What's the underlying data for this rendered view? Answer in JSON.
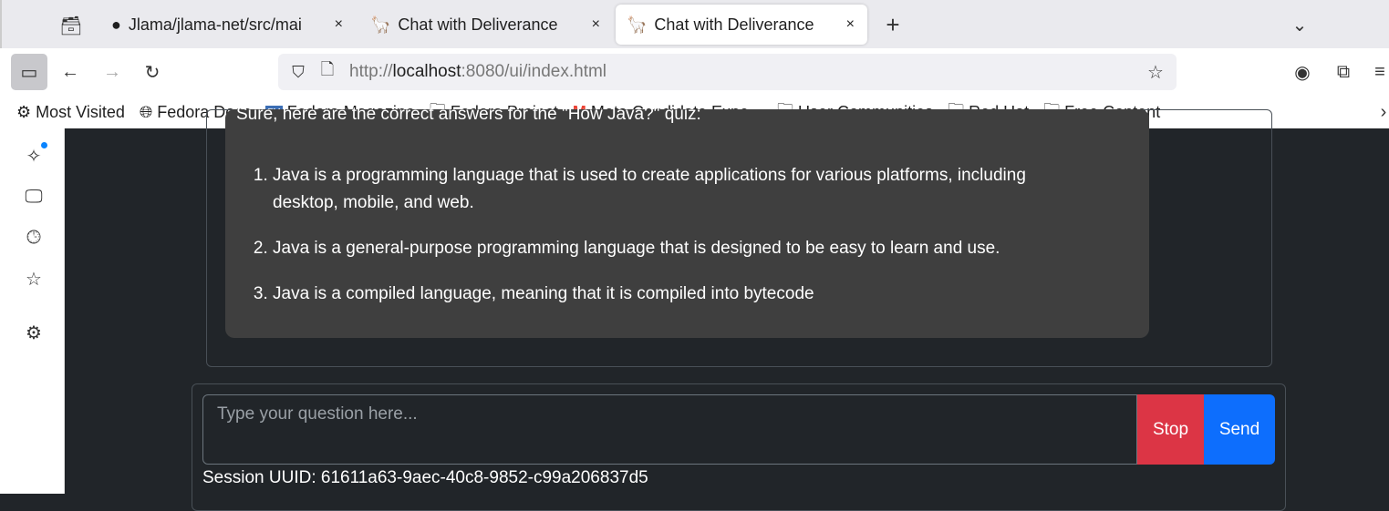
{
  "browser": {
    "tabs": [
      {
        "label": "Jlama/jlama-net/src/mai",
        "icon": "github-icon"
      },
      {
        "label": "Chat with Deliverance",
        "icon": "llama-icon"
      },
      {
        "label": "Chat with Deliverance",
        "icon": "llama-icon",
        "active": true
      }
    ],
    "close": "×",
    "new_tab": "+",
    "url_prefix": "http://",
    "url_host": "localhost",
    "url_rest": ":8080/ui/index.html",
    "bookmarks": [
      "Most Visited",
      "Fedora Docs",
      "Fedora Magazine",
      "Fedora Project",
      "Meta Candidate Expe...",
      "User Communities",
      "Red Hat",
      "Free Content"
    ]
  },
  "chat": {
    "intro": "Sure, here are the correct answers for the \"How Java?\" quiz:",
    "items": [
      "Java is a programming language that is used to create applications for various platforms, including desktop, mobile, and web.",
      "Java is a general-purpose programming language that is designed to be easy to learn and use.",
      "Java is a compiled language, meaning that it is compiled into bytecode"
    ]
  },
  "input": {
    "placeholder": "Type your question here...",
    "value": ""
  },
  "buttons": {
    "stop": "Stop",
    "send": "Send"
  },
  "session": "Session UUID: 61611a63-9aec-40c8-9852-c99a206837d5",
  "colors": {
    "stop": "#dc3545",
    "send": "#0d6efd",
    "bg": "#212529",
    "bubble": "#3f3f3f"
  }
}
